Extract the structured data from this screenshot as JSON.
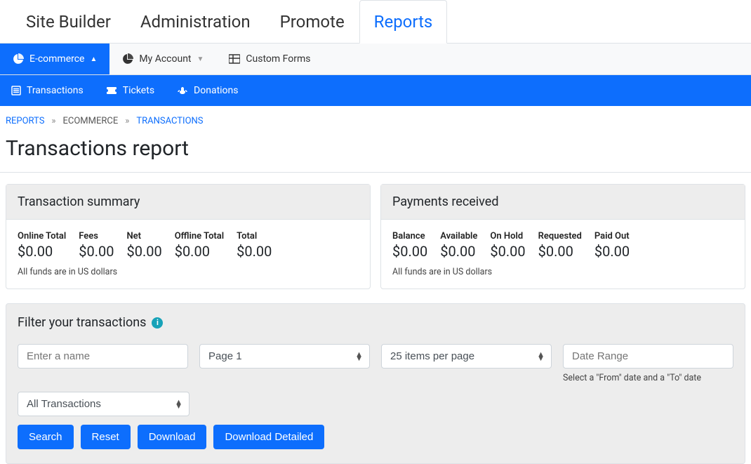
{
  "topnav": {
    "items": [
      "Site Builder",
      "Administration",
      "Promote",
      "Reports"
    ],
    "active": 3
  },
  "subnav": {
    "items": [
      {
        "label": "E-commerce",
        "icon": "pie"
      },
      {
        "label": "My Account",
        "icon": "pie"
      },
      {
        "label": "Custom Forms",
        "icon": "grid"
      }
    ],
    "active": 0
  },
  "subnav2": {
    "items": [
      {
        "label": "Transactions",
        "icon": "list"
      },
      {
        "label": "Tickets",
        "icon": "ticket"
      },
      {
        "label": "Donations",
        "icon": "hands"
      }
    ]
  },
  "breadcrumb": {
    "items": [
      "REPORTS",
      "ECOMMERCE",
      "TRANSACTIONS"
    ]
  },
  "page_title": "Transactions report",
  "summary_panel": {
    "title": "Transaction summary",
    "stats": [
      {
        "label": "Online Total",
        "value": "$0.00"
      },
      {
        "label": "Fees",
        "value": "$0.00"
      },
      {
        "label": "Net",
        "value": "$0.00"
      },
      {
        "label": "Offline Total",
        "value": "$0.00"
      },
      {
        "label": "Total",
        "value": "$0.00"
      }
    ],
    "note": "All funds are in US dollars"
  },
  "payments_panel": {
    "title": "Payments received",
    "stats": [
      {
        "label": "Balance",
        "value": "$0.00"
      },
      {
        "label": "Available",
        "value": "$0.00"
      },
      {
        "label": "On Hold",
        "value": "$0.00"
      },
      {
        "label": "Requested",
        "value": "$0.00"
      },
      {
        "label": "Paid Out",
        "value": "$0.00"
      }
    ],
    "note": "All funds are in US dollars"
  },
  "filter": {
    "title": "Filter your transactions",
    "name_placeholder": "Enter a name",
    "page_select": "Page 1",
    "perpage_select": "25 items per page",
    "date_placeholder": "Date Range",
    "date_helper": "Select a \"From\" date and a \"To\" date",
    "type_select": "All Transactions",
    "buttons": {
      "search": "Search",
      "reset": "Reset",
      "download": "Download",
      "download_detailed": "Download Detailed"
    }
  }
}
